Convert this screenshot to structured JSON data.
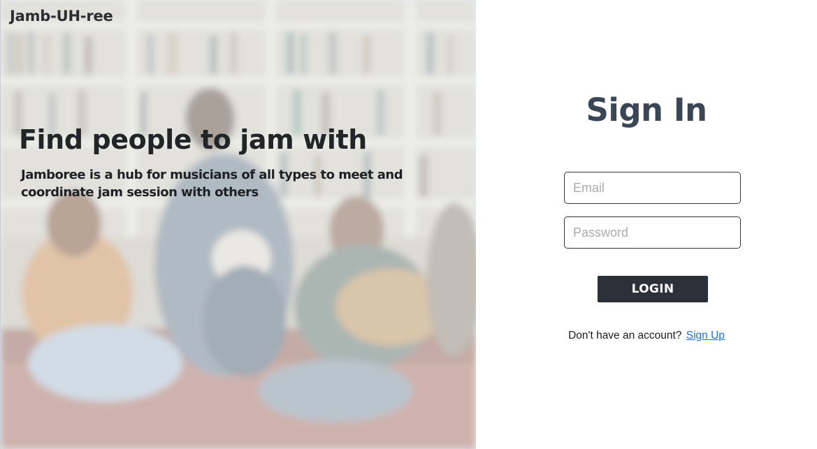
{
  "brand": {
    "name": "Jamb-UH-ree"
  },
  "hero": {
    "headline": "Find people to jam with",
    "tagline": "Jamboree is a hub for musicians of all types to meet and coordinate jam session with others",
    "image": "musicians-jamming-background-photo"
  },
  "signin": {
    "title": "Sign In",
    "email_placeholder": "Email",
    "email_value": "",
    "password_placeholder": "Password",
    "password_value": "",
    "login_label": "LOGIN",
    "no_account_text": "Don't have an account?",
    "signup_label": "Sign Up"
  },
  "colors": {
    "title": "#3a4556",
    "button_bg": "#2b3039",
    "link": "#1a6fd6"
  }
}
